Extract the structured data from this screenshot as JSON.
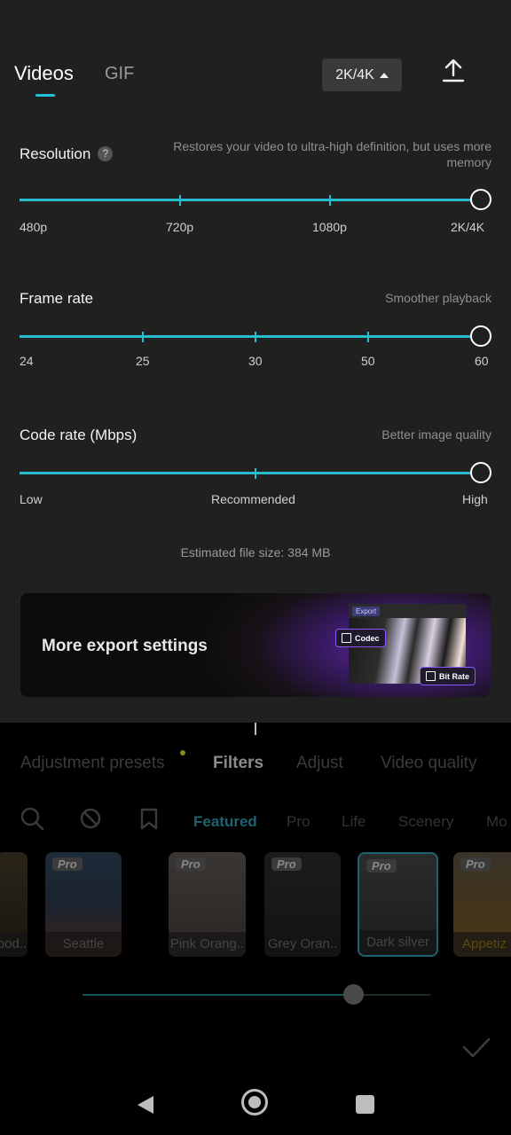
{
  "header": {
    "tabs": [
      {
        "label": "Videos",
        "active": true
      },
      {
        "label": "GIF",
        "active": false
      }
    ],
    "resolution_button": "2K/4K",
    "upload_icon": "upload-icon"
  },
  "resolution": {
    "title": "Resolution",
    "help": "?",
    "description": "Restores your video to ultra-high definition, but uses more memory",
    "ticks": [
      "480p",
      "720p",
      "1080p",
      "2K/4K"
    ],
    "selected": "2K/4K"
  },
  "frame_rate": {
    "title": "Frame rate",
    "description": "Smoother playback",
    "ticks": [
      "24",
      "25",
      "30",
      "50",
      "60"
    ],
    "selected": "60"
  },
  "code_rate": {
    "title": "Code rate (Mbps)",
    "description": "Better image quality",
    "ticks": [
      "Low",
      "Recommended",
      "High"
    ],
    "selected": "High"
  },
  "file_size": "Estimated file size: 384 MB",
  "banner": {
    "title": "More export settings",
    "mock_export": "Export",
    "codec": "Codec",
    "bit_rate": "Bit Rate"
  },
  "panel_tabs": [
    {
      "label": "Adjustment presets",
      "active": false
    },
    {
      "label": "Filters",
      "active": true
    },
    {
      "label": "Adjust",
      "active": false
    },
    {
      "label": "Video quality",
      "active": false
    }
  ],
  "filter_categories": [
    {
      "label": "Featured",
      "active": true
    },
    {
      "label": "Pro",
      "active": false
    },
    {
      "label": "Life",
      "active": false
    },
    {
      "label": "Scenery",
      "active": false
    },
    {
      "label": "Mo",
      "active": false
    }
  ],
  "filters": [
    {
      "label": "ood..",
      "pro": false
    },
    {
      "label": "Seattle",
      "pro": true
    },
    {
      "label": "Pink Orang..",
      "pro": true
    },
    {
      "label": "Grey Oran..",
      "pro": true
    },
    {
      "label": "Dark silver",
      "pro": true,
      "selected": true
    },
    {
      "label": "Appetiz",
      "pro": true
    }
  ],
  "pro_badge": "Pro",
  "intensity": 0.78,
  "colors": {
    "accent": "#28bcd0",
    "sheet": "#202020"
  }
}
